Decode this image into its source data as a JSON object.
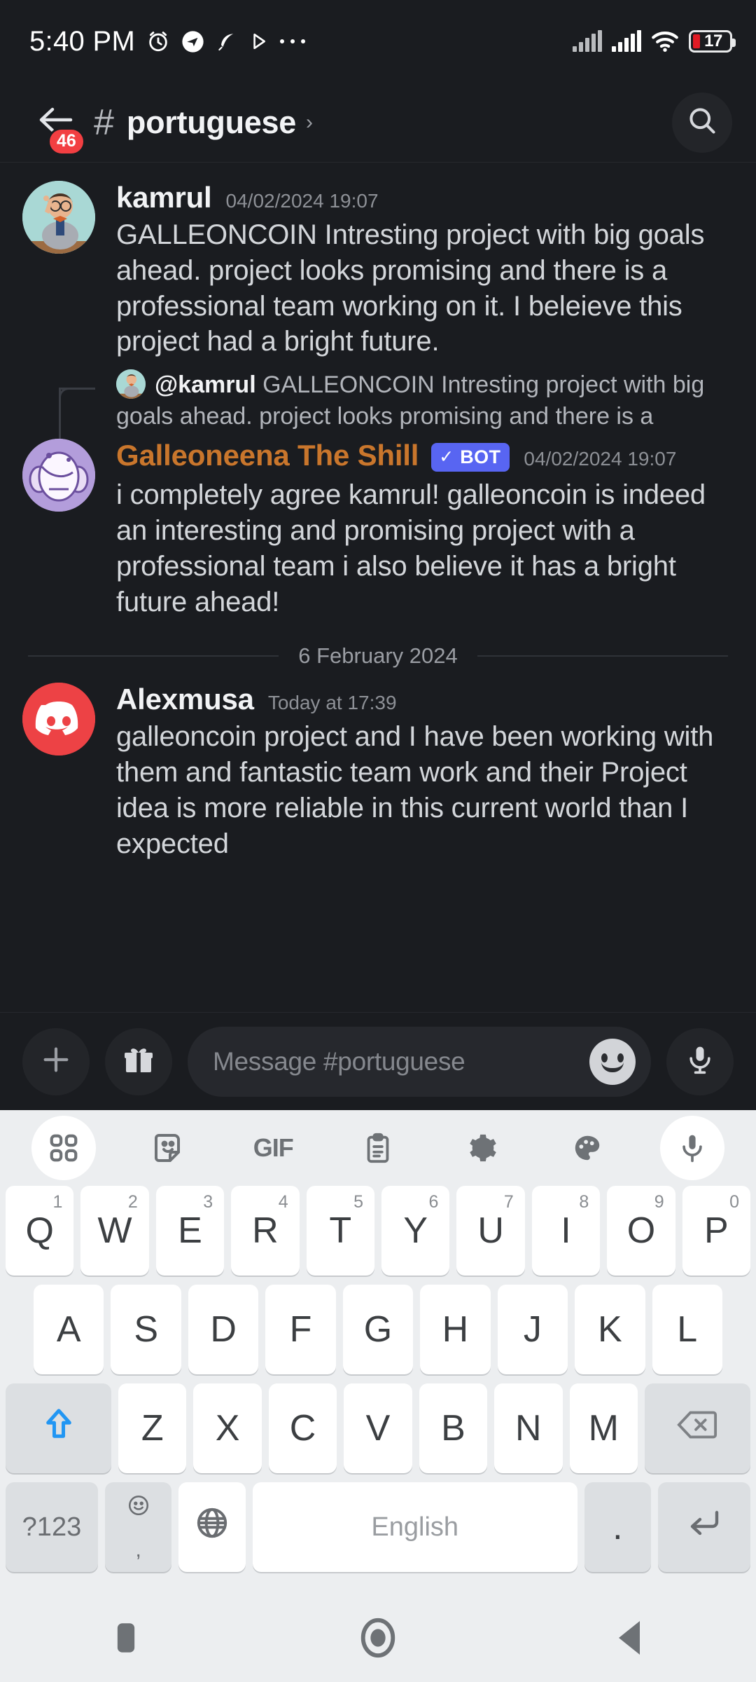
{
  "status_bar": {
    "time": "5:40 PM",
    "left_icons": [
      "alarm-icon",
      "telegram-icon",
      "feather-icon",
      "play-icon",
      "more-dots-icon"
    ],
    "battery_percent": "17",
    "battery_color": "#e01b24",
    "right_icons": [
      "signal-bars-1-icon",
      "signal-bars-2-icon",
      "wifi-icon",
      "battery-icon"
    ]
  },
  "header": {
    "back_icon": "back-arrow-icon",
    "unread_badge": "46",
    "badge_color": "#f23f42",
    "hash": "#",
    "channel_name": "portuguese",
    "chevron": "›",
    "search_icon": "search-icon"
  },
  "messages": [
    {
      "author": "kamrul",
      "timestamp": "04/02/2024 19:07",
      "text": "GALLEONCOIN Intresting project with big goals ahead. project looks promising and there is a professional team working on it. I beleieve this project had a bright future.",
      "avatar": "kamrul-avatar",
      "is_bot": false
    }
  ],
  "reply_reference": {
    "avatar": "kamrul-avatar-small",
    "mention": "@kamrul",
    "text": "GALLEONCOIN Intresting project with big goals ahead. project looks promising and there is a"
  },
  "bot_message": {
    "author": "Galleoneena The Shill",
    "author_color": "#c9762c",
    "bot_tag": "BOT",
    "bot_tag_color": "#5865f2",
    "bot_tag_check": "✓",
    "timestamp": "04/02/2024 19:07",
    "text": "i completely agree kamrul! galleoncoin is indeed an interesting and promising project with a professional team i also believe it has a bright future ahead!",
    "avatar": "galleoneena-bot-avatar"
  },
  "date_divider": "6 February 2024",
  "last_message": {
    "author": "Alexmusa",
    "timestamp": "Today at 17:39",
    "text": "galleoncoin project and I have been working with them and fantastic team work and their Project idea is more reliable in this current world than I expected",
    "avatar": "discord-logo-avatar",
    "avatar_color": "#ed4245"
  },
  "composer": {
    "add_icon": "plus-icon",
    "gift_icon": "gift-icon",
    "placeholder": "Message #portuguese",
    "emoji_icon": "smiley-icon",
    "mic_icon": "microphone-icon"
  },
  "keyboard": {
    "toolbar": [
      {
        "name": "grid-icon",
        "label": ""
      },
      {
        "name": "sticker-icon",
        "label": ""
      },
      {
        "name": "gif-icon",
        "label": "GIF"
      },
      {
        "name": "clipboard-icon",
        "label": ""
      },
      {
        "name": "gear-icon",
        "label": ""
      },
      {
        "name": "palette-icon",
        "label": ""
      },
      {
        "name": "microphone-icon",
        "label": ""
      }
    ],
    "row1": [
      {
        "key": "Q",
        "sup": "1"
      },
      {
        "key": "W",
        "sup": "2"
      },
      {
        "key": "E",
        "sup": "3"
      },
      {
        "key": "R",
        "sup": "4"
      },
      {
        "key": "T",
        "sup": "5"
      },
      {
        "key": "Y",
        "sup": "6"
      },
      {
        "key": "U",
        "sup": "7"
      },
      {
        "key": "I",
        "sup": "8"
      },
      {
        "key": "O",
        "sup": "9"
      },
      {
        "key": "P",
        "sup": "0"
      }
    ],
    "row2": [
      "A",
      "S",
      "D",
      "F",
      "G",
      "H",
      "J",
      "K",
      "L"
    ],
    "row3": {
      "shift": "shift-icon",
      "letters": [
        "Z",
        "X",
        "C",
        "V",
        "B",
        "N",
        "M"
      ],
      "delete": "backspace-icon"
    },
    "row4": {
      "symbols": "?123",
      "emoji": "smiley-small-icon",
      "comma": ",",
      "globe": "globe-icon",
      "space": "English",
      "period": ".",
      "enter": "enter-icon"
    },
    "shift_color": "#2196f3"
  },
  "navbar": {
    "recents": "square-icon",
    "home": "circle-icon",
    "back": "triangle-back-icon"
  }
}
